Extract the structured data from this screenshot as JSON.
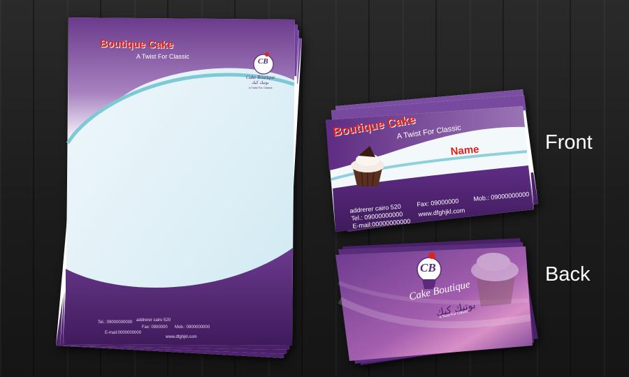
{
  "colors": {
    "brand_purple": "#5b2a7a",
    "accent_red": "#d9251c",
    "light_blue": "#e6f4fa"
  },
  "letterhead": {
    "brand_title": "Boutique Cake",
    "tagline": "A Twist For Classic",
    "logo_monogram": "CB",
    "logo_wordmark": "Cake Boutique",
    "logo_arabic": "بوتيك كيك",
    "logo_small_tagline": "A Twist For Classic",
    "footer": {
      "tel": "Tel.: 09000000000",
      "address": "addrerer cairo 520",
      "fax": "Fax: 0900000",
      "mob": "Mob.: 0900000000",
      "email": "E-mail:0000000000",
      "web": "www.dfghjkl.com"
    }
  },
  "card_front": {
    "brand_title": "Boutique Cake",
    "tagline": "A Twist For Classic",
    "name": "Name",
    "address": "addrerer cairo 520",
    "tel": "Tel.: 09000000000",
    "email": "E-mail:00000000000",
    "fax": "Fax: 09000000",
    "mob": "Mob.: 09000000000",
    "web": "www.dfghjkl.com"
  },
  "card_back": {
    "logo_monogram": "CB",
    "logo_wordmark": "Cake Boutique",
    "logo_arabic": "بوتيك كيك",
    "logo_small_tagline": "A Twist For Classic"
  },
  "labels": {
    "front": "Front",
    "back": "Back"
  }
}
